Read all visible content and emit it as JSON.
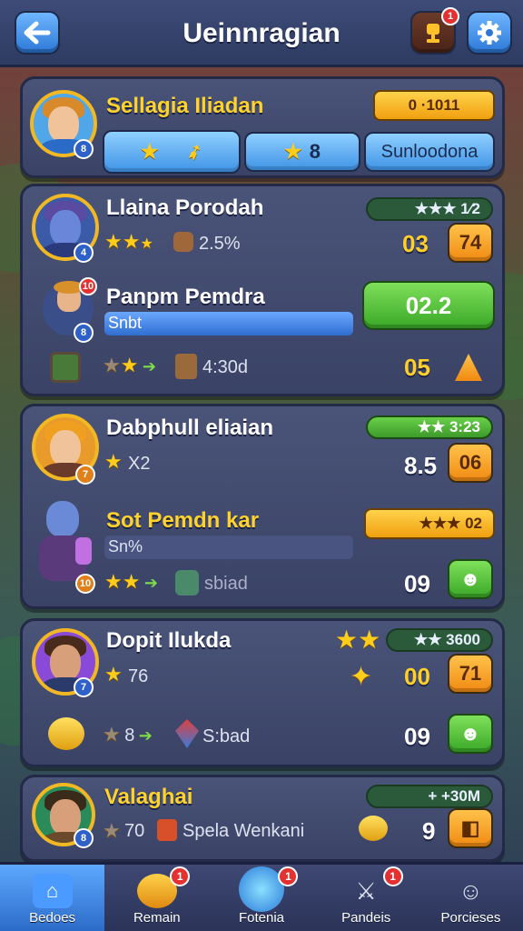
{
  "header": {
    "title": "Ueinnragian",
    "trophy_badge": "1"
  },
  "profile": {
    "name": "Sellagia Iliadan",
    "level": "8",
    "score_pill": "0 ·1011",
    "chip2_value": "8",
    "chip3_label": "Sunloodona"
  },
  "players": [
    {
      "name": "Llaina Porodah",
      "level": "4",
      "stat": "2.5%",
      "pill": "★★★ 1⁄2",
      "value": "03",
      "button": "74",
      "sub_name": "Panpm Pemdra",
      "sub_level": "8",
      "sub_badge": "10",
      "sub_bar_label": "Snbt",
      "sub_button": "02.2",
      "sub_item_stat": "4:30d",
      "sub_value": "05"
    },
    {
      "name": "Dabphull eliaian",
      "level": "7",
      "stat": "X2",
      "pill": "★★ 3:23",
      "value": "8.5",
      "button": "06",
      "sub_name": "Sot Pemdn kar",
      "sub_level": "10",
      "sub_bar_label": "Sn%",
      "sub_pill": "★★★ 02",
      "sub_item_stat": "sbiad",
      "sub_value": "09"
    },
    {
      "name": "Dopit Ilukda",
      "level": "7",
      "stat": "76",
      "pill": "★★ 3600",
      "value": "00",
      "button": "71",
      "sub_stat_value": "8",
      "sub_item_stat": "S:bad",
      "sub_value": "09"
    },
    {
      "name": "Valaghai",
      "level": "8",
      "stat": "70",
      "stat_label": "Spela Wenkani",
      "pill": "+ +30M",
      "value": "9"
    }
  ],
  "nav": [
    {
      "label": "Bedoes",
      "icon": "home-icon"
    },
    {
      "label": "Remain",
      "icon": "coin-icon",
      "badge": "1"
    },
    {
      "label": "Fotenia",
      "icon": "globe-icon",
      "badge": "1"
    },
    {
      "label": "Pandeis",
      "icon": "sword-icon",
      "badge": "1"
    },
    {
      "label": "Porcieses",
      "icon": "friends-icon"
    }
  ],
  "colors": {
    "accent_blue": "#2c78d6",
    "gold": "#ffcc1a",
    "green": "#3aa828",
    "panel": "#3a4366"
  }
}
